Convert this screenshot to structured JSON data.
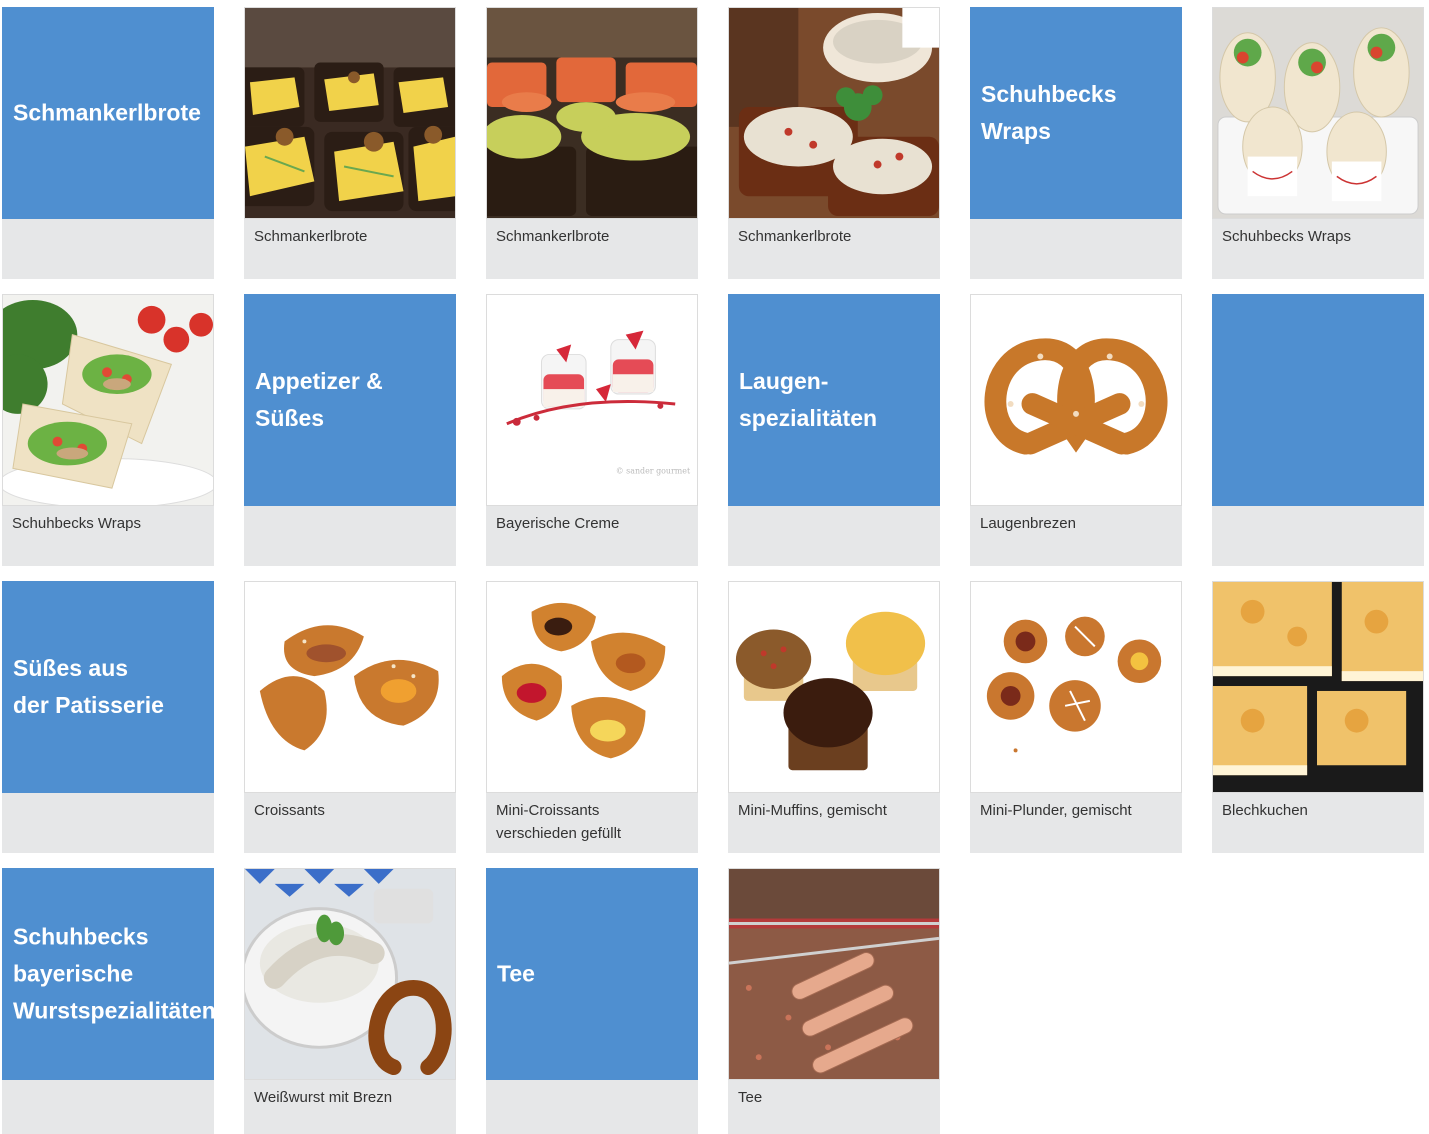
{
  "colors": {
    "tile_blue": "#4f8fd0",
    "caption_bg": "#e6e7e8",
    "caption_text": "#333333"
  },
  "tiles": [
    {
      "kind": "category",
      "title": "Schmankerlbrote"
    },
    {
      "kind": "product",
      "caption": "Schmankerlbrote",
      "icon": "cheese-bread-icon"
    },
    {
      "kind": "product",
      "caption": "Schmankerlbrote",
      "icon": "salmon-bread-icon"
    },
    {
      "kind": "product",
      "caption": "Schmankerlbrote",
      "icon": "spread-bread-icon"
    },
    {
      "kind": "category",
      "title": "Schuhbecks\nWraps"
    },
    {
      "kind": "product",
      "caption": "Schuhbecks Wraps",
      "icon": "wraps-dish-icon"
    },
    {
      "kind": "product",
      "caption": "Schuhbecks Wraps",
      "icon": "wraps-plate-icon"
    },
    {
      "kind": "category",
      "title": "Appetizer & Süßes"
    },
    {
      "kind": "product",
      "caption": "Bayerische Creme",
      "icon": "cream-glass-icon"
    },
    {
      "kind": "category",
      "title": "Laugen-\nspezialitäten"
    },
    {
      "kind": "product",
      "caption": "Laugenbrezen",
      "icon": "pretzel-icon"
    },
    {
      "kind": "category",
      "title": ""
    },
    {
      "kind": "category",
      "title": "Süßes aus\nder Patisserie"
    },
    {
      "kind": "product",
      "caption": "Croissants",
      "icon": "croissant-icon"
    },
    {
      "kind": "product",
      "caption": "Mini-Croissants\nverschieden gefüllt",
      "icon": "mini-croissant-icon"
    },
    {
      "kind": "product",
      "caption": "Mini-Muffins, gemischt",
      "icon": "muffin-icon"
    },
    {
      "kind": "product",
      "caption": "Mini-Plunder, gemischt",
      "icon": "danish-pastry-icon"
    },
    {
      "kind": "product",
      "caption": "Blechkuchen",
      "icon": "sheet-cake-icon"
    },
    {
      "kind": "category",
      "title": "Schuhbecks\nbayerische\nWurstspezialitäten"
    },
    {
      "kind": "product",
      "caption": "Weißwurst mit Brezn",
      "icon": "weisswurst-icon"
    },
    {
      "kind": "category",
      "title": "Tee"
    },
    {
      "kind": "product",
      "caption": "Tee",
      "icon": "tea-scoop-icon"
    }
  ]
}
